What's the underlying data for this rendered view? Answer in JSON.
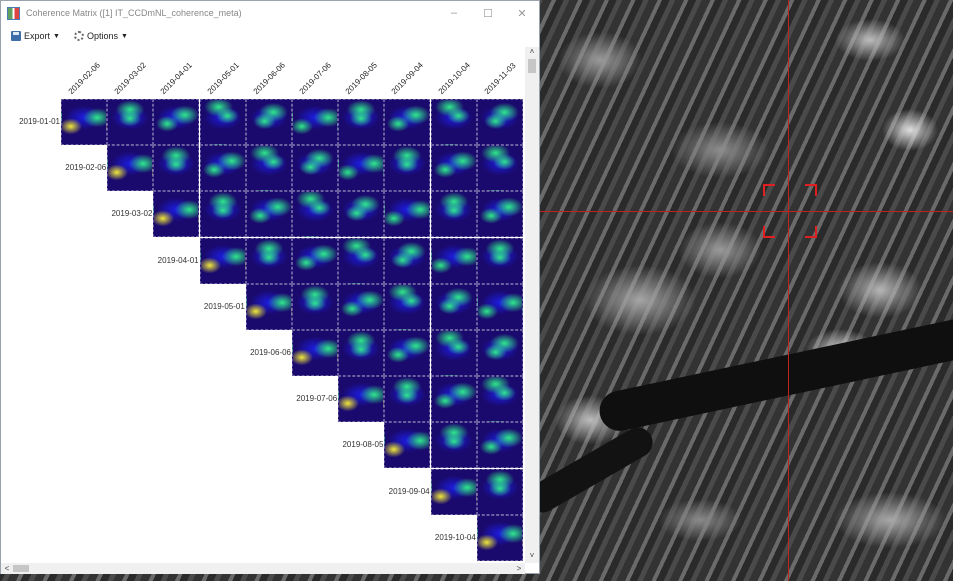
{
  "window": {
    "title": "Coherence Matrix ([1] IT_CCDmNL_coherence_meta)",
    "minimize": "–",
    "maximize": "☐",
    "close": "✕"
  },
  "toolbar": {
    "export_label": "Export",
    "options_label": "Options"
  },
  "matrix": {
    "columns": [
      "2019-02-06",
      "2019-03-02",
      "2019-04-01",
      "2019-05-01",
      "2019-06-06",
      "2019-07-06",
      "2019-08-05",
      "2019-09-04",
      "2019-10-04",
      "2019-11-03"
    ],
    "rows": [
      "2019-01-01",
      "2019-02-06",
      "2019-03-02",
      "2019-04-01",
      "2019-05-01",
      "2019-06-06",
      "2019-07-06",
      "2019-08-05",
      "2019-09-04",
      "2019-10-04"
    ]
  },
  "scroll": {
    "up": "˄",
    "down": "˅",
    "left": "<",
    "right": ">"
  },
  "colors": {
    "crosshair": "#c0221f",
    "target": "#e02020",
    "cell_high": "#f0e83a",
    "cell_mid": "#2ee88a",
    "cell_low": "#1c1ce0",
    "cell_bg": "#1a0a6e"
  }
}
